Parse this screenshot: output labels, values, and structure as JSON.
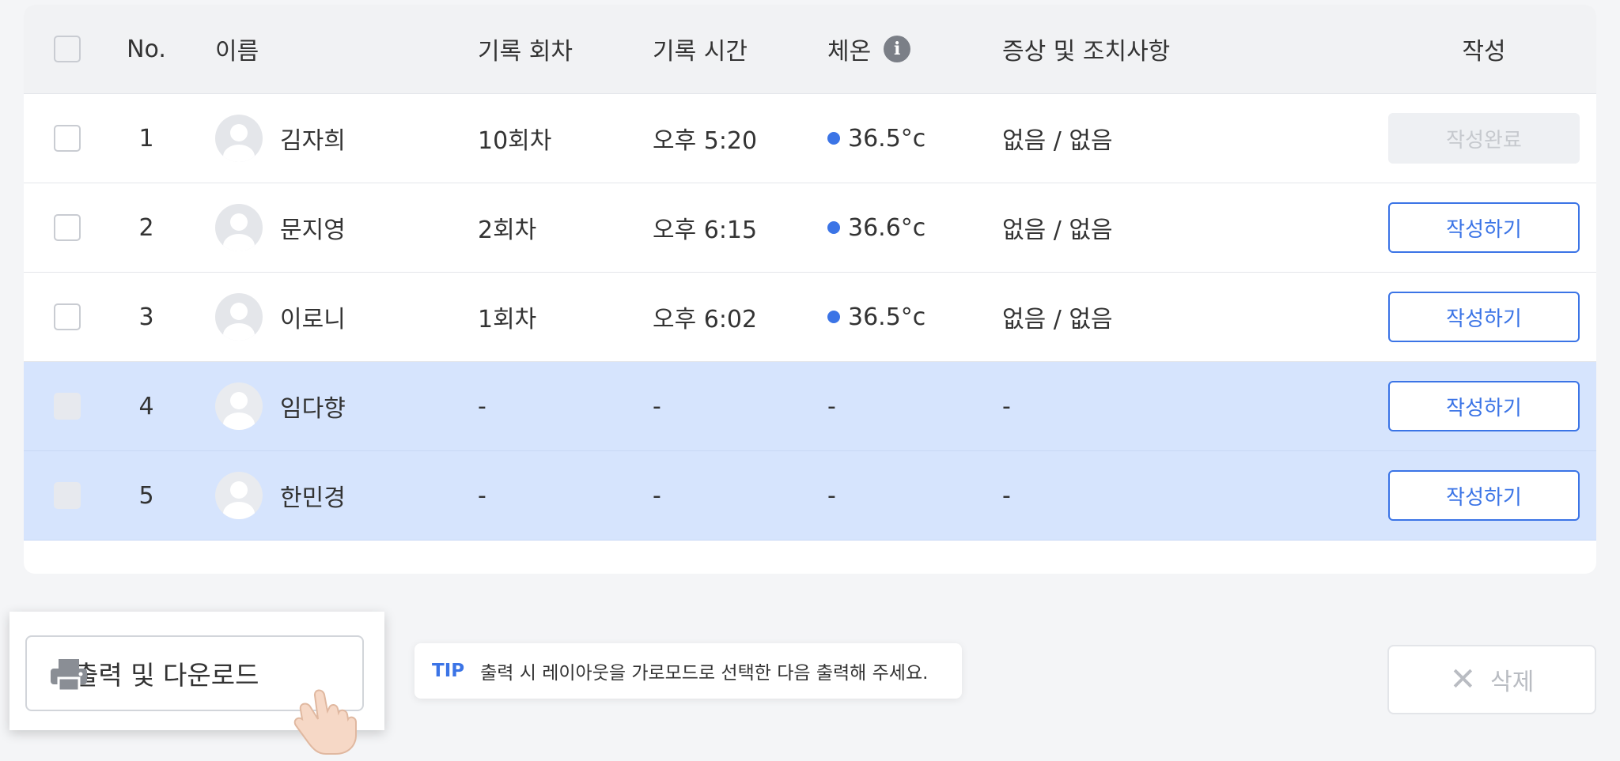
{
  "table": {
    "headers": {
      "no": "No.",
      "name": "이름",
      "round": "기록 회차",
      "time": "기록 시간",
      "temp": "체온",
      "symptoms": "증상 및 조치사항",
      "action": "작성"
    },
    "rows": [
      {
        "no": "1",
        "name": "김자희",
        "round": "10회차",
        "time": "오후 5:20",
        "temp": "36.5°c",
        "symptoms": "없음 / 없음",
        "action": "작성완료",
        "status": "done",
        "selected": false
      },
      {
        "no": "2",
        "name": "문지영",
        "round": "2회차",
        "time": "오후 6:15",
        "temp": "36.6°c",
        "symptoms": "없음 / 없음",
        "action": "작성하기",
        "status": "write",
        "selected": false
      },
      {
        "no": "3",
        "name": "이로니",
        "round": "1회차",
        "time": "오후 6:02",
        "temp": "36.5°c",
        "symptoms": "없음 / 없음",
        "action": "작성하기",
        "status": "write",
        "selected": false
      },
      {
        "no": "4",
        "name": "임다향",
        "round": "-",
        "time": "-",
        "temp": "-",
        "symptoms": "-",
        "action": "작성하기",
        "status": "write",
        "selected": true
      },
      {
        "no": "5",
        "name": "한민경",
        "round": "-",
        "time": "-",
        "temp": "-",
        "symptoms": "-",
        "action": "작성하기",
        "status": "write",
        "selected": true
      }
    ]
  },
  "footer": {
    "print_label": "출력 및 다운로드",
    "tip_label": "TIP",
    "tip_text": "출력 시 레이아웃을 가로모드로 선택한 다음 출력해 주세요.",
    "delete_label": "삭제"
  },
  "icons": {
    "info": "info-icon",
    "printer": "printer-icon",
    "hand": "hand-pointer-icon",
    "close": "close-icon",
    "avatar": "user-avatar-icon"
  },
  "colors": {
    "accent": "#3b74e6",
    "selected_row": "#d6e4fd",
    "header_bg": "#f1f2f4"
  }
}
